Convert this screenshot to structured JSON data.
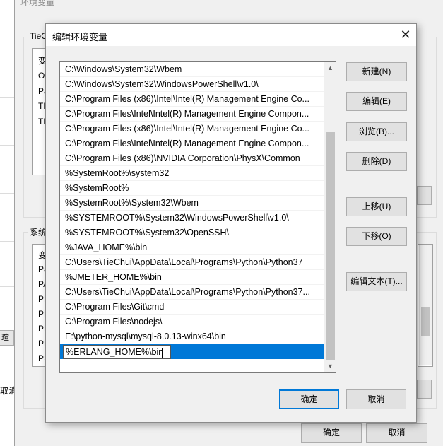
{
  "left_app": {
    "btn1": "瑄",
    "text1": "取消"
  },
  "background_dialog": {
    "title": "环境变量",
    "user_group_label": "TieC",
    "user_rows": [
      "变",
      "O",
      "Pa",
      "TE",
      "TM"
    ],
    "system_group_label": "系统",
    "system_rows": [
      "变",
      "Pa",
      "PA",
      "PF",
      "PF",
      "PF",
      "PF",
      "PS"
    ],
    "ok": "确定",
    "cancel": "取消"
  },
  "dialog": {
    "title": "编辑环境变量",
    "close_glyph": "✕",
    "paths": [
      "C:\\Windows\\System32\\Wbem",
      "C:\\Windows\\System32\\WindowsPowerShell\\v1.0\\",
      "C:\\Program Files (x86)\\Intel\\Intel(R) Management Engine Co...",
      "C:\\Program Files\\Intel\\Intel(R) Management Engine Compon...",
      "C:\\Program Files (x86)\\Intel\\Intel(R) Management Engine Co...",
      "C:\\Program Files\\Intel\\Intel(R) Management Engine Compon...",
      "C:\\Program Files (x86)\\NVIDIA Corporation\\PhysX\\Common",
      "%SystemRoot%\\system32",
      "%SystemRoot%",
      "%SystemRoot%\\System32\\Wbem",
      "%SYSTEMROOT%\\System32\\WindowsPowerShell\\v1.0\\",
      "%SYSTEMROOT%\\System32\\OpenSSH\\",
      "%JAVA_HOME%\\bin",
      "C:\\Users\\TieChui\\AppData\\Local\\Programs\\Python\\Python37",
      "%JMETER_HOME%\\bin",
      "C:\\Users\\TieChui\\AppData\\Local\\Programs\\Python\\Python37...",
      "C:\\Program Files\\Git\\cmd",
      "C:\\Program Files\\nodejs\\",
      "E:\\python-mysql\\mysql-8.0.13-winx64\\bin",
      "%ERLANG_HOME%\\bin"
    ],
    "buttons": {
      "new": "新建(N)",
      "edit": "编辑(E)",
      "browse": "浏览(B)...",
      "delete": "删除(D)",
      "move_up": "上移(U)",
      "move_down": "下移(O)",
      "edit_text": "编辑文本(T)..."
    },
    "ok": "确定",
    "cancel": "取消",
    "accent": "#0078d7"
  }
}
